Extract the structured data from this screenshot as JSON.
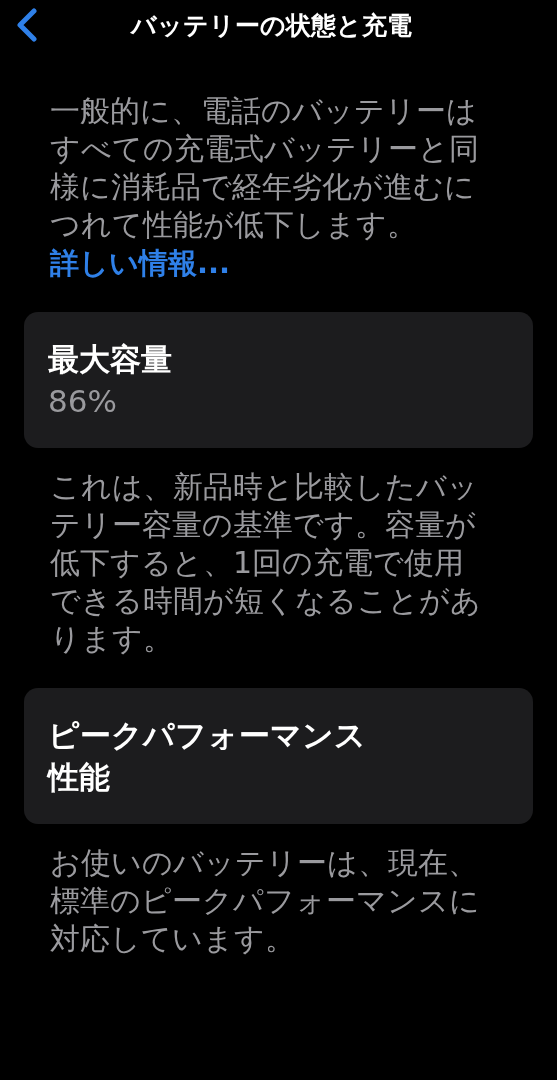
{
  "nav": {
    "title": "バッテリーの状態と充電"
  },
  "intro": {
    "text": "一般的に、電話のバッテリーはすべての充電式バッテリーと同様に消耗品で経年劣化が進むにつれて性能が低下します。",
    "link": "詳しい情報..."
  },
  "sections": [
    {
      "title": "最大容量",
      "value": "86%",
      "description": "これは、新品時と比較したバッテリー容量の基準です。容量が低下すると、1回の充電で使用できる時間が短くなることがあります。"
    },
    {
      "title": "ピークパフォーマンス性能",
      "description": "お使いのバッテリーは、現在、標準のピークパフォーマンスに対応しています。"
    }
  ]
}
